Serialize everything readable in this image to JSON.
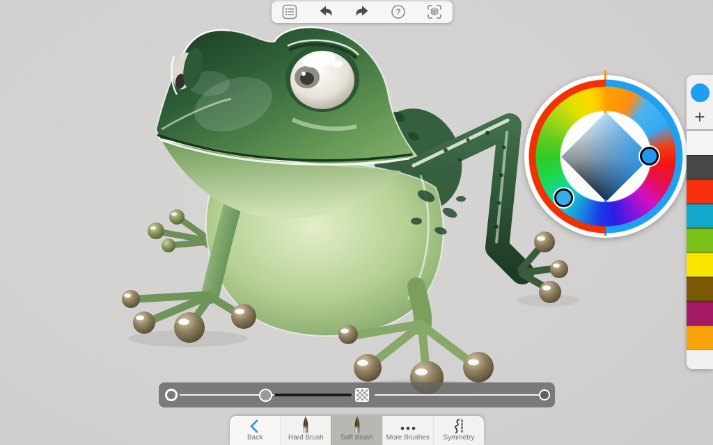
{
  "top_toolbar": {
    "icons": [
      {
        "name": "brush-list-icon"
      },
      {
        "name": "undo-icon"
      },
      {
        "name": "redo-icon"
      },
      {
        "name": "help-icon"
      },
      {
        "name": "fit-to-view-cube-icon"
      }
    ]
  },
  "color_editor": {
    "current_color": "#1D9EF1",
    "add_swatch_label": "+",
    "outer_ring_left_half": "#F23000",
    "outer_ring_right_half": "#1E9FF2",
    "top_tick_color": "#FF9800",
    "bottom_tick_color": "#2196F3",
    "hue_handle_color": "#35AEE8",
    "sat_handle_color": "#2196F3",
    "swatches": [
      "#474747",
      "#F8300E",
      "#12A8CA",
      "#7CC01C",
      "#F8E600",
      "#7A5A06",
      "#A41A66",
      "#F8A30A"
    ]
  },
  "slider_bar": {
    "left_slider_value": 0.5,
    "right_slider_value": 1.0,
    "checker_icon": "transparency-checker-icon"
  },
  "bottom_toolbar": {
    "items": [
      {
        "label": "Back",
        "icon": "back-chevron-icon",
        "selected": false
      },
      {
        "label": "Hard Brush",
        "icon": "hard-brush-icon",
        "selected": false
      },
      {
        "label": "Soft Brush",
        "icon": "soft-brush-icon",
        "selected": true
      },
      {
        "label": "More Brushes",
        "icon": "more-dots-icon",
        "selected": false
      },
      {
        "label": "Symmetry",
        "icon": "symmetry-icon",
        "selected": false
      }
    ]
  }
}
